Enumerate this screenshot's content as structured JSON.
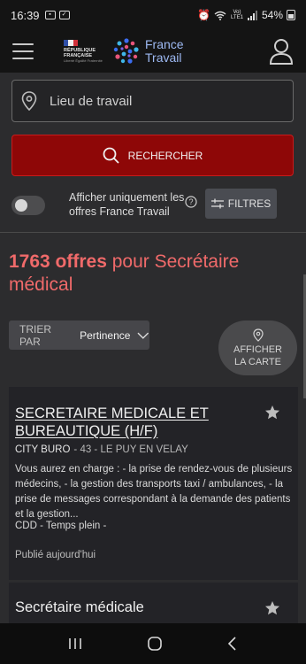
{
  "status_bar": {
    "time": "16:39",
    "battery": "54%",
    "network": "Vo) LTE1"
  },
  "header": {
    "republique_line1": "RÉPUBLIQUE",
    "republique_line2": "FRANÇAISE",
    "republique_motto": "Liberté Égalité Fraternité",
    "brand_line1": "France",
    "brand_line2": "Travail"
  },
  "search": {
    "location_placeholder": "Lieu de travail",
    "search_label": "RECHERCHER"
  },
  "filters": {
    "toggle_label": "Afficher uniquement les offres France Travail",
    "toggle_on": false,
    "filters_label": "FILTRES"
  },
  "results": {
    "count": "1763 offres",
    "query_text": " pour Secrétaire médical"
  },
  "sort": {
    "label": "TRIER PAR",
    "value": "Pertinence"
  },
  "map_button": {
    "line1": "AFFICHER",
    "line2": "LA CARTE"
  },
  "offers": [
    {
      "title": "SECRETAIRE MEDICALE ET BUREAUTIQUE (H/F)",
      "company": "CITY BURO",
      "location": "- 43 - LE PUY EN VELAY",
      "description": "Vous aurez en charge : - la prise de rendez-vous de plusieurs médecins, - la gestion des transports taxi / ambulances, - la prise de messages correspondant à la demande des patients et la gestion...",
      "contract": "CDD  - Temps plein -",
      "published": "Publié aujourd'hui"
    },
    {
      "title": "Secrétaire médicale"
    }
  ],
  "colors": {
    "accent_red": "#8e0707",
    "title_red": "#f06a6a",
    "brand_blue": "#9db9f2"
  }
}
